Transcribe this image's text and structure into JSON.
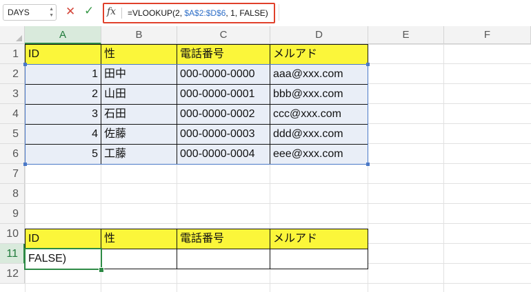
{
  "formula_bar": {
    "name_box": "DAYS",
    "cancel_icon": "✕",
    "enter_icon": "✓",
    "fx_label": "fx",
    "formula_prefix": "=VLOOKUP(2, ",
    "formula_ref": "$A$2:$D$6",
    "formula_suffix": ", 1, FALSE)"
  },
  "columns": [
    "A",
    "B",
    "C",
    "D",
    "E",
    "F"
  ],
  "rows": [
    "1",
    "2",
    "3",
    "4",
    "5",
    "6",
    "7",
    "8",
    "9",
    "10",
    "11",
    "12"
  ],
  "table": {
    "headers": [
      "ID",
      "性",
      "電話番号",
      "メルアド"
    ],
    "data": [
      [
        "1",
        "田中",
        "000-0000-0000",
        "aaa@xxx.com"
      ],
      [
        "2",
        "山田",
        "000-0000-0001",
        "bbb@xxx.com"
      ],
      [
        "3",
        "石田",
        "000-0000-0002",
        "ccc@xxx.com"
      ],
      [
        "4",
        "佐藤",
        "000-0000-0003",
        "ddd@xxx.com"
      ],
      [
        "5",
        "工藤",
        "000-0000-0004",
        "eee@xxx.com"
      ]
    ]
  },
  "lookup": {
    "headers": [
      "ID",
      "性",
      "電話番号",
      "メルアド"
    ],
    "input": [
      "FALSE)",
      "",
      "",
      ""
    ]
  },
  "active_cell": "A11",
  "colors": {
    "header_fill": "#fbf63a",
    "data_fill": "#e9eef7",
    "active_green": "#2d8a45",
    "range_blue": "#4a78c7",
    "highlight_red": "#e0402a"
  }
}
